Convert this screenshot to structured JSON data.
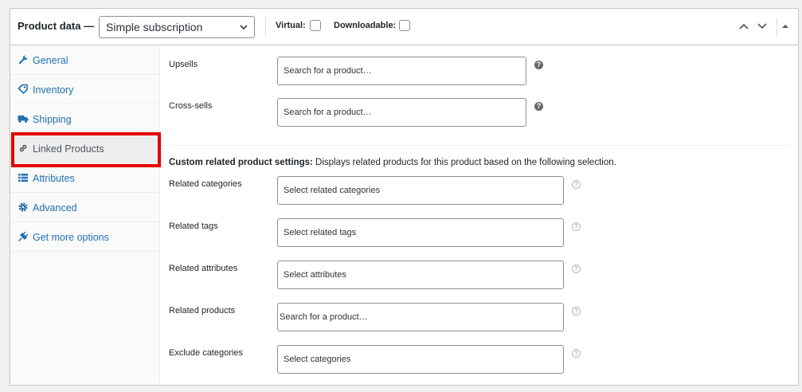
{
  "header": {
    "title": "Product data —",
    "product_type": "Simple subscription",
    "virtual_label": "Virtual:",
    "downloadable_label": "Downloadable:"
  },
  "tabs": [
    {
      "label": "General",
      "icon": "wrench-icon"
    },
    {
      "label": "Inventory",
      "icon": "tag-icon"
    },
    {
      "label": "Shipping",
      "icon": "truck-icon"
    },
    {
      "label": "Linked Products",
      "icon": "link-icon",
      "active": true
    },
    {
      "label": "Attributes",
      "icon": "list-icon"
    },
    {
      "label": "Advanced",
      "icon": "gear-icon"
    },
    {
      "label": "Get more options",
      "icon": "plugin-icon"
    }
  ],
  "linked": {
    "upsells_label": "Upsells",
    "upsells_placeholder": "Search for a product…",
    "crosssells_label": "Cross-sells",
    "crosssells_placeholder": "Search for a product…",
    "custom_title": "Custom related product settings:",
    "custom_desc": " Displays related products for this product based on the following selection.",
    "related_categories_label": "Related categories",
    "related_categories_placeholder": "Select related categories",
    "related_tags_label": "Related tags",
    "related_tags_placeholder": "Select related tags",
    "related_attributes_label": "Related attributes",
    "related_attributes_placeholder": "Select attributes",
    "related_products_label": "Related products",
    "related_products_placeholder": "Search for a product…",
    "exclude_categories_label": "Exclude categories",
    "exclude_categories_placeholder": "Select categories"
  },
  "colors": {
    "link": "#2271b1",
    "highlight": "#e00000"
  }
}
